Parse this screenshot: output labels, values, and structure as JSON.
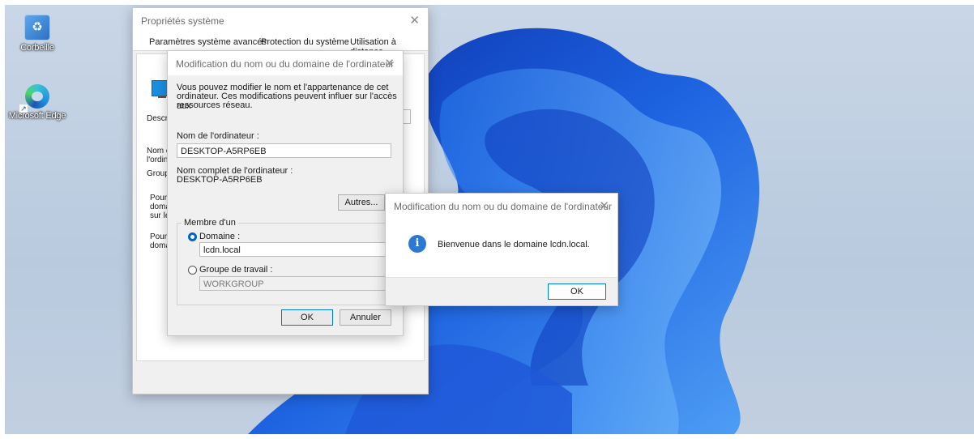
{
  "desktop": {
    "icons": [
      {
        "label": "Corbeille",
        "icon": "recycle-bin-icon"
      },
      {
        "label": "Microsoft Edge",
        "icon": "edge-browser-icon"
      }
    ],
    "shortcut_arrow": "↗"
  },
  "system_properties": {
    "title": "Propriétés système",
    "close": "✕",
    "tabs": [
      "Paramètres système avancés",
      "Protection du système",
      "Utilisation à distance"
    ],
    "partial_labels": [
      "Descrip",
      "Nom co",
      "l'ordinat",
      "Groupe",
      "Pour u",
      "domai",
      "sur le r",
      "Pour r",
      "domai"
    ]
  },
  "edit_dialog": {
    "title": "Modification du nom ou du domaine de l'ordinateur",
    "close": "✕",
    "intro": [
      "Vous pouvez modifier le nom et l'appartenance de cet",
      "ordinateur. Ces modifications peuvent influer sur l'accès aux",
      "ressources réseau."
    ],
    "computer_name_label": "Nom de l'ordinateur :",
    "computer_name_value": "DESKTOP-A5RP6EB",
    "full_name_label": "Nom complet de l'ordinateur :",
    "full_name_value": "DESKTOP-A5RP6EB",
    "other_button": "Autres...",
    "member_of": "Membre d'un",
    "domain_label": "Domaine :",
    "domain_value": "lcdn.local",
    "workgroup_label": "Groupe de travail :",
    "workgroup_value": "WORKGROUP",
    "ok": "OK",
    "cancel": "Annuler",
    "selected": "domain"
  },
  "message_box": {
    "title": "Modification du nom ou du domaine de l'ordinateur",
    "close": "✕",
    "icon": "information-icon",
    "icon_glyph": "i",
    "message": "Bienvenue dans le domaine lcdn.local.",
    "ok": "OK"
  },
  "colors": {
    "accent": "#0067c0",
    "info": "#2b79d3",
    "wallpaper_blue": "#1f5bd6"
  }
}
